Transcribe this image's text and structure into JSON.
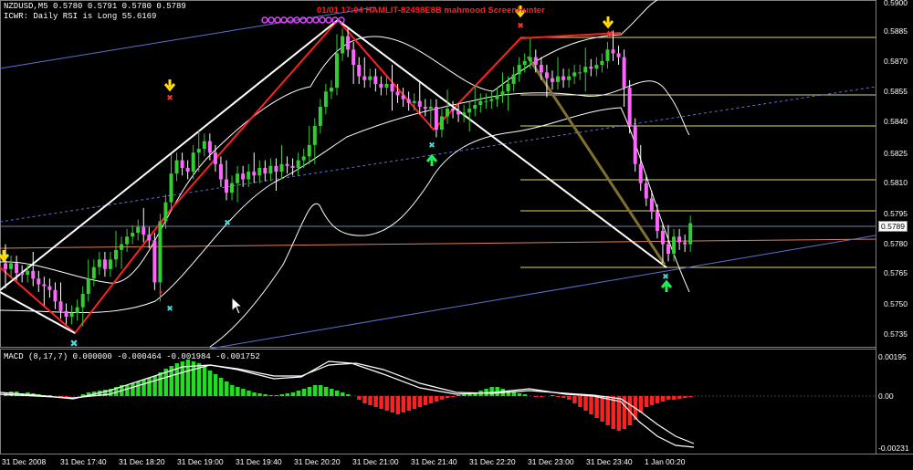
{
  "header": {
    "symbol_line": "NZDUSD,M5  0.5780 0.5791 0.5780 0.5789",
    "indicator_line": "ICWR: Daily RSI is Long 55.6169",
    "overlay_red": "01/01  17:04  HAMLIT-82498E8B  mahmood ScreenHunter"
  },
  "price_axis": {
    "labels": [
      "0.5900",
      "0.5885",
      "0.5870",
      "0.5855",
      "0.5840",
      "0.5825",
      "0.5810",
      "0.5795",
      "0.5780",
      "0.5765",
      "0.5750",
      "0.5735"
    ],
    "current_price": "0.5789"
  },
  "macd": {
    "label": "MACD  (8,17,7)  0.000000  -0.000464  -0.001984  -0.001752",
    "axis_labels": [
      "0.00195",
      "0.00",
      "-0.00231"
    ]
  },
  "time_axis": {
    "labels": [
      "31 Dec 2008",
      "31 Dec 17:40",
      "31 Dec 18:20",
      "31 Dec 19:00",
      "31 Dec 19:40",
      "31 Dec 20:20",
      "31 Dec 21:00",
      "31 Dec 21:40",
      "31 Dec 22:20",
      "31 Dec 23:00",
      "31 Dec 23:40",
      "1 Jan 00:20"
    ]
  },
  "colors": {
    "background": "#000000",
    "bull_candle": "#33cc33",
    "bear_candle": "#ff66ff",
    "zigzag_red": "#ff2020",
    "zigzag_white": "#ffffff",
    "bands": "#ffffff",
    "channel": "#6070d0",
    "fib": "#e0d870",
    "macd_pos": "#22dd22",
    "macd_neg": "#ff2020",
    "arrow_up": "#22ee55",
    "arrow_down": "#ffdd00"
  },
  "chart_data": {
    "type": "candlestick",
    "symbol": "NZDUSD",
    "timeframe": "M5",
    "ylim": [
      0.573,
      0.5905
    ],
    "bars": 125,
    "close": [
      0.5765,
      0.5768,
      0.5763,
      0.5762,
      0.5764,
      0.576,
      0.5757,
      0.5756,
      0.5754,
      0.5748,
      0.5743,
      0.574,
      0.5742,
      0.5745,
      0.5752,
      0.576,
      0.5766,
      0.577,
      0.5765,
      0.577,
      0.5775,
      0.5778,
      0.5782,
      0.5784,
      0.5787,
      0.5783,
      0.578,
      0.5758,
      0.579,
      0.58,
      0.5815,
      0.5822,
      0.5818,
      0.5816,
      0.5826,
      0.5828,
      0.5832,
      0.5826,
      0.582,
      0.5812,
      0.5805,
      0.581,
      0.5815,
      0.5812,
      0.5816,
      0.5814,
      0.5818,
      0.5815,
      0.5819,
      0.5816,
      0.582,
      0.5819,
      0.5818,
      0.5822,
      0.5824,
      0.583,
      0.584,
      0.585,
      0.5858,
      0.586,
      0.5878,
      0.5887,
      0.588,
      0.5872,
      0.5866,
      0.5864,
      0.5866,
      0.5862,
      0.586,
      0.5862,
      0.5858,
      0.5856,
      0.5854,
      0.5852,
      0.5853,
      0.585,
      0.5849,
      0.585,
      0.5838,
      0.5845,
      0.5849,
      0.5848,
      0.5846,
      0.5847,
      0.5849,
      0.5851,
      0.5853,
      0.5853,
      0.5854,
      0.5856,
      0.5858,
      0.5862,
      0.5867,
      0.5872,
      0.5874,
      0.5876,
      0.5872,
      0.5868,
      0.5865,
      0.5863,
      0.5866,
      0.5864,
      0.5866,
      0.5868,
      0.5868,
      0.5871,
      0.587,
      0.5872,
      0.5874,
      0.588,
      0.5878,
      0.5876,
      0.586,
      0.584,
      0.582,
      0.581,
      0.5802,
      0.5795,
      0.5785,
      0.5778,
      0.5773,
      0.5782,
      0.5779,
      0.5778,
      0.5789
    ]
  }
}
